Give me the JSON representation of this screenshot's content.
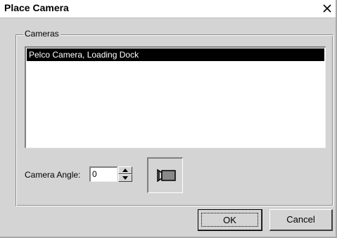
{
  "window": {
    "title": "Place Camera",
    "close_glyph": "✕"
  },
  "cameras_group": {
    "label": "Cameras",
    "items": [
      {
        "label": "Pelco Camera, Loading Dock",
        "selected": true
      }
    ]
  },
  "camera_angle": {
    "label": "Camera Angle:",
    "value": "0",
    "spin_up_icon": "arrow-up-icon",
    "spin_down_icon": "arrow-down-icon"
  },
  "preview": {
    "icon": "video-camera-icon"
  },
  "buttons": {
    "ok_label": "OK",
    "cancel_label": "Cancel"
  },
  "colors": {
    "dialog_bg": "#d4d4d4",
    "selection_bg": "#000000",
    "selection_text": "#ffffff"
  }
}
